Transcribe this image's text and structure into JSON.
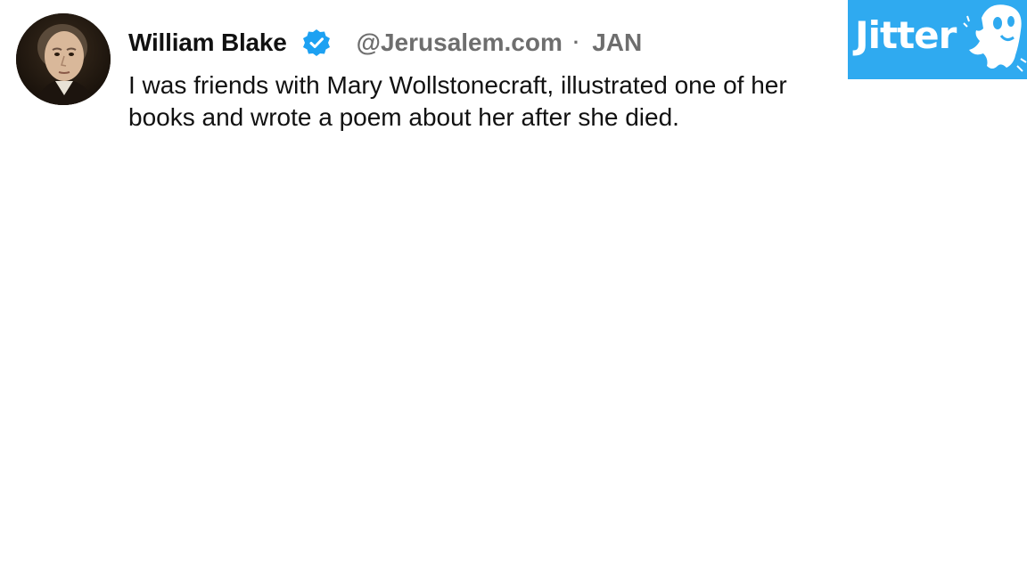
{
  "post": {
    "display_name": "William Blake",
    "handle": "@Jerusalem.com",
    "separator": "·",
    "date": "JAN",
    "text": "I was friends with Mary Wollstonecraft, illustrated one of her books and wrote a poem about her after she died."
  },
  "icons": {
    "avatar": "portrait-avatar",
    "verified": "verified-badge-icon",
    "logo_mascot": "ghost-icon"
  },
  "brand": {
    "name": "Jitter",
    "color": "#2faaf0"
  },
  "colors": {
    "name_text": "#111111",
    "muted_text": "#6e6e6e",
    "verified": "#1da1f2"
  }
}
